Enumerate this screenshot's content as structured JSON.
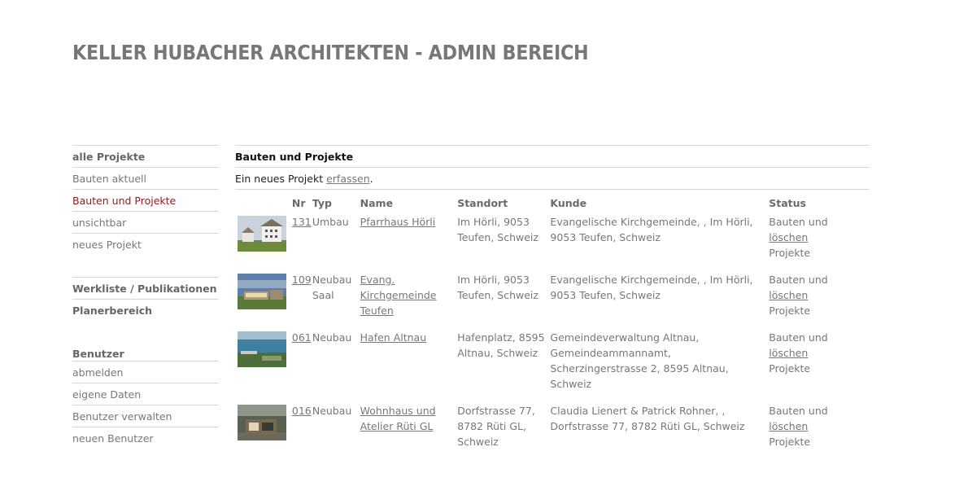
{
  "header": {
    "title": "KELLER HUBACHER ARCHITEKTEN - ADMIN BEREICH"
  },
  "sidebar": {
    "projects": [
      {
        "label": "alle Projekte"
      },
      {
        "label": "Bauten aktuell"
      },
      {
        "label": "Bauten und Projekte"
      },
      {
        "label": "unsichtbar"
      },
      {
        "label": "neues Projekt"
      }
    ],
    "links": [
      {
        "label": "Werkliste / Publikationen"
      },
      {
        "label": "Planerbereich"
      }
    ],
    "users": {
      "heading": "Benutzer",
      "items": [
        {
          "label": "abmelden"
        },
        {
          "label": "eigene Daten"
        },
        {
          "label": "Benutzer verwalten"
        },
        {
          "label": "neuen Benutzer"
        }
      ]
    }
  },
  "main": {
    "title": "Bauten und Projekte",
    "intro_text": "Ein neues Projekt ",
    "intro_link": "erfassen",
    "intro_end": ".",
    "columns": {
      "nr": "Nr",
      "typ": "Typ",
      "name": "Name",
      "standort": "Standort",
      "kunde": "Kunde",
      "status": "Status"
    },
    "delete_label": "löschen",
    "rows": [
      {
        "nr": "131",
        "typ": "Umbau",
        "name": "Pfarrhaus Hörli",
        "standort": "Im Hörli, 9053 Teufen, Schweiz",
        "kunde": "Evangelische Kirchgemeinde, , Im Hörli, 9053 Teufen, Schweiz",
        "status": "Bauten und Projekte"
      },
      {
        "nr": "109",
        "typ": "Neubau Saal",
        "name": "Evang. Kirchgemeinde Teufen",
        "standort": "Im Hörli, 9053 Teufen, Schweiz",
        "kunde": "Evangelische Kirchgemeinde, , Im Hörli, 9053 Teufen, Schweiz",
        "status": "Bauten und Projekte"
      },
      {
        "nr": "061",
        "typ": "Neubau",
        "name": "Hafen Altnau",
        "standort": "Hafenplatz, 8595 Altnau, Schweiz",
        "kunde": "Gemeindeverwaltung Altnau, Gemeindeammannamt, Scherzingerstrasse 2, 8595 Altnau, Schweiz",
        "status": "Bauten und Projekte"
      },
      {
        "nr": "016",
        "typ": "Neubau",
        "name": "Wohnhaus und Atelier Rüti GL",
        "standort": "Dorfstrasse 77, 8782 Rüti GL, Schweiz",
        "kunde": "Claudia Lienert & Patrick Rohner, , Dorfstrasse 77, 8782 Rüti GL, Schweiz",
        "status": "Bauten und Projekte"
      }
    ]
  },
  "colors": {
    "text": "#777777",
    "active": "#8e1b1b",
    "divider": "#d4d4d4"
  }
}
